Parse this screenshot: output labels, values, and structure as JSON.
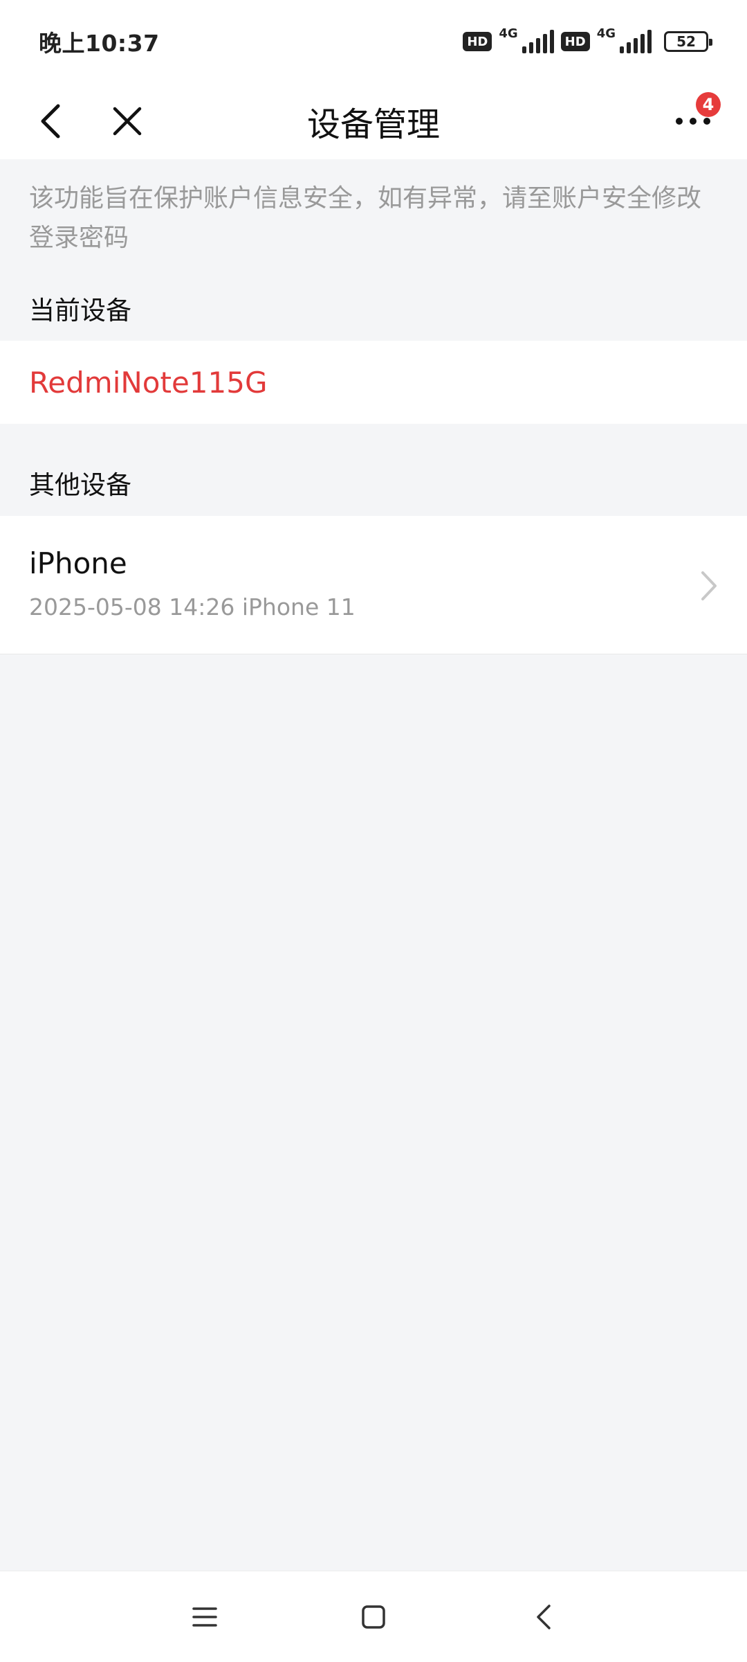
{
  "status_bar": {
    "time": "晚上10:37",
    "hd_label": "HD",
    "network_1": "4G",
    "network_2": "4G",
    "battery": "52"
  },
  "nav": {
    "title": "设备管理",
    "more_badge": "4"
  },
  "notice": {
    "text": "该功能旨在保护账户信息安全，如有异常，请至账户安全修改登录密码"
  },
  "current_device": {
    "section_label": "当前设备",
    "name": "RedmiNote115G"
  },
  "other_devices": {
    "section_label": "其他设备",
    "items": [
      {
        "name": "iPhone",
        "detail": "2025-05-08 14:26 iPhone 11"
      }
    ]
  },
  "colors": {
    "accent_red": "#e23a3a",
    "background": "#f4f5f7",
    "muted_text": "#999999"
  },
  "icons": {
    "back": "chevron-left-icon",
    "close": "close-icon",
    "more": "more-dots-icon",
    "row_chevron": "chevron-right-icon",
    "sys_menu": "menu-lines-icon",
    "sys_home": "home-square-icon",
    "sys_back": "back-triangle-icon"
  }
}
